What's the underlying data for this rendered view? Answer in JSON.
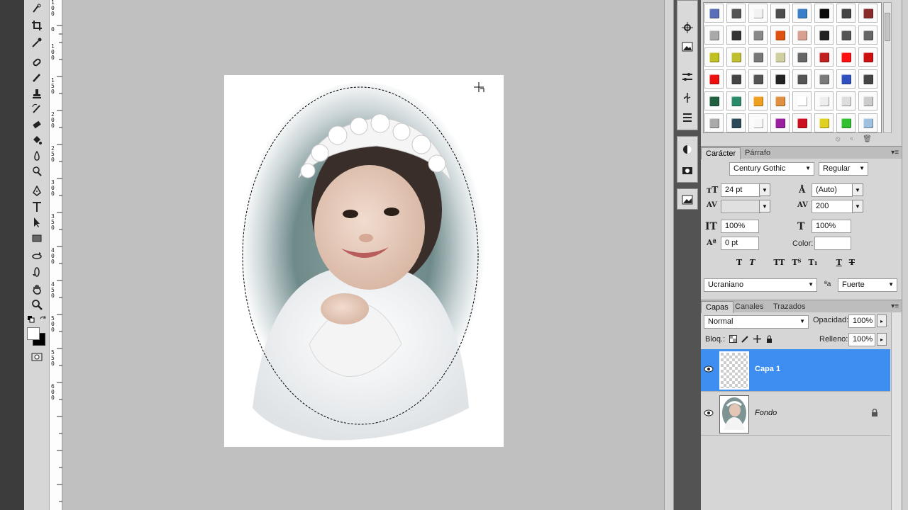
{
  "character_panel": {
    "tab_character": "Carácter",
    "tab_paragraph": "Párrafo",
    "font_family": "Century Gothic",
    "font_style": "Regular",
    "font_size": "24 pt",
    "leading": "(Auto)",
    "kerning": "",
    "tracking": "200",
    "vertical_scale": "100%",
    "horizontal_scale": "100%",
    "baseline_shift": "0 pt",
    "color_label": "Color:",
    "language": "Ucraniano",
    "antialias_symbol": "a",
    "antialias": "Fuerte",
    "style_buttons": [
      "T",
      "T",
      "TT",
      "Tᵀ",
      "T₁",
      "T",
      "T"
    ]
  },
  "layers_panel": {
    "tab_layers": "Capas",
    "tab_channels": "Canales",
    "tab_paths": "Trazados",
    "blend_mode": "Normal",
    "opacity_label": "Opacidad:",
    "opacity": "100%",
    "lock_label": "Bloq.:",
    "fill_label": "Relleno:",
    "fill": "100%",
    "layers": [
      {
        "name": "Capa 1",
        "selected": true,
        "visible": true,
        "locked": false
      },
      {
        "name": "Fondo",
        "selected": false,
        "visible": true,
        "locked": true
      }
    ]
  },
  "ruler": {
    "labels": [
      "1\n0\n0",
      "0",
      "1\n0\n0",
      "1\n5\n0",
      "2\n0\n0",
      "2\n5\n0",
      "3\n0\n0",
      "3\n5\n0",
      "4\n0\n0",
      "4\n5\n0",
      "5\n0\n0",
      "5\n5\n0",
      "6\n0\n0"
    ]
  },
  "swatch_colors": [
    [
      "#5a6fb8",
      "#555555",
      "#f2f2f2",
      "#4d4d4d",
      "#3a7fc8",
      "#0a0a0a",
      "#444444",
      "#8a2a2a"
    ],
    [
      "#aaaaaa",
      "#333333",
      "#888888",
      "#e05010",
      "#d8a090",
      "#222222",
      "#555555",
      "#666666"
    ],
    [
      "#c0c020",
      "#bfbf30",
      "#777777",
      "#cfcfa0",
      "#666666",
      "#c02020",
      "#ff1010",
      "#cc1010"
    ],
    [
      "#ee1010",
      "#444444",
      "#555555",
      "#222222",
      "#555555",
      "#7a7a7a",
      "#3050c0",
      "#444444"
    ],
    [
      "#206040",
      "#2a8a6a",
      "#f0a020",
      "#e09040",
      "#ffffff",
      "#eeeeee",
      "#dddddd",
      "#cccccc"
    ],
    [
      "#aaaaaa",
      "#2a4a5a",
      "#f8f8f8",
      "#9a20a0",
      "#cc1020",
      "#e0d020",
      "#30c030",
      "#a0c0e0"
    ]
  ]
}
